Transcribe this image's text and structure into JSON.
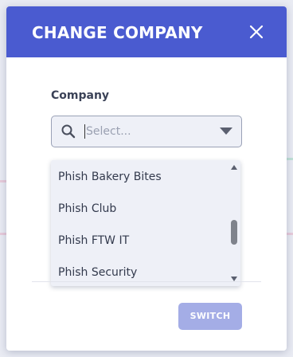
{
  "modal": {
    "title": "CHANGE COMPANY",
    "close_icon": "close-icon",
    "header_color": "#4a5bd0"
  },
  "company_field": {
    "label": "Company",
    "placeholder": "Select...",
    "value": "",
    "search_icon": "search-icon",
    "dropdown_icon": "chevron-down-icon"
  },
  "dropdown": {
    "options": [
      "Phish Bakery Bites",
      "Phish Club",
      "Phish FTW IT",
      "Phish Security"
    ]
  },
  "footer": {
    "switch_label": "SWITCH",
    "switch_color": "#a4ade6"
  }
}
